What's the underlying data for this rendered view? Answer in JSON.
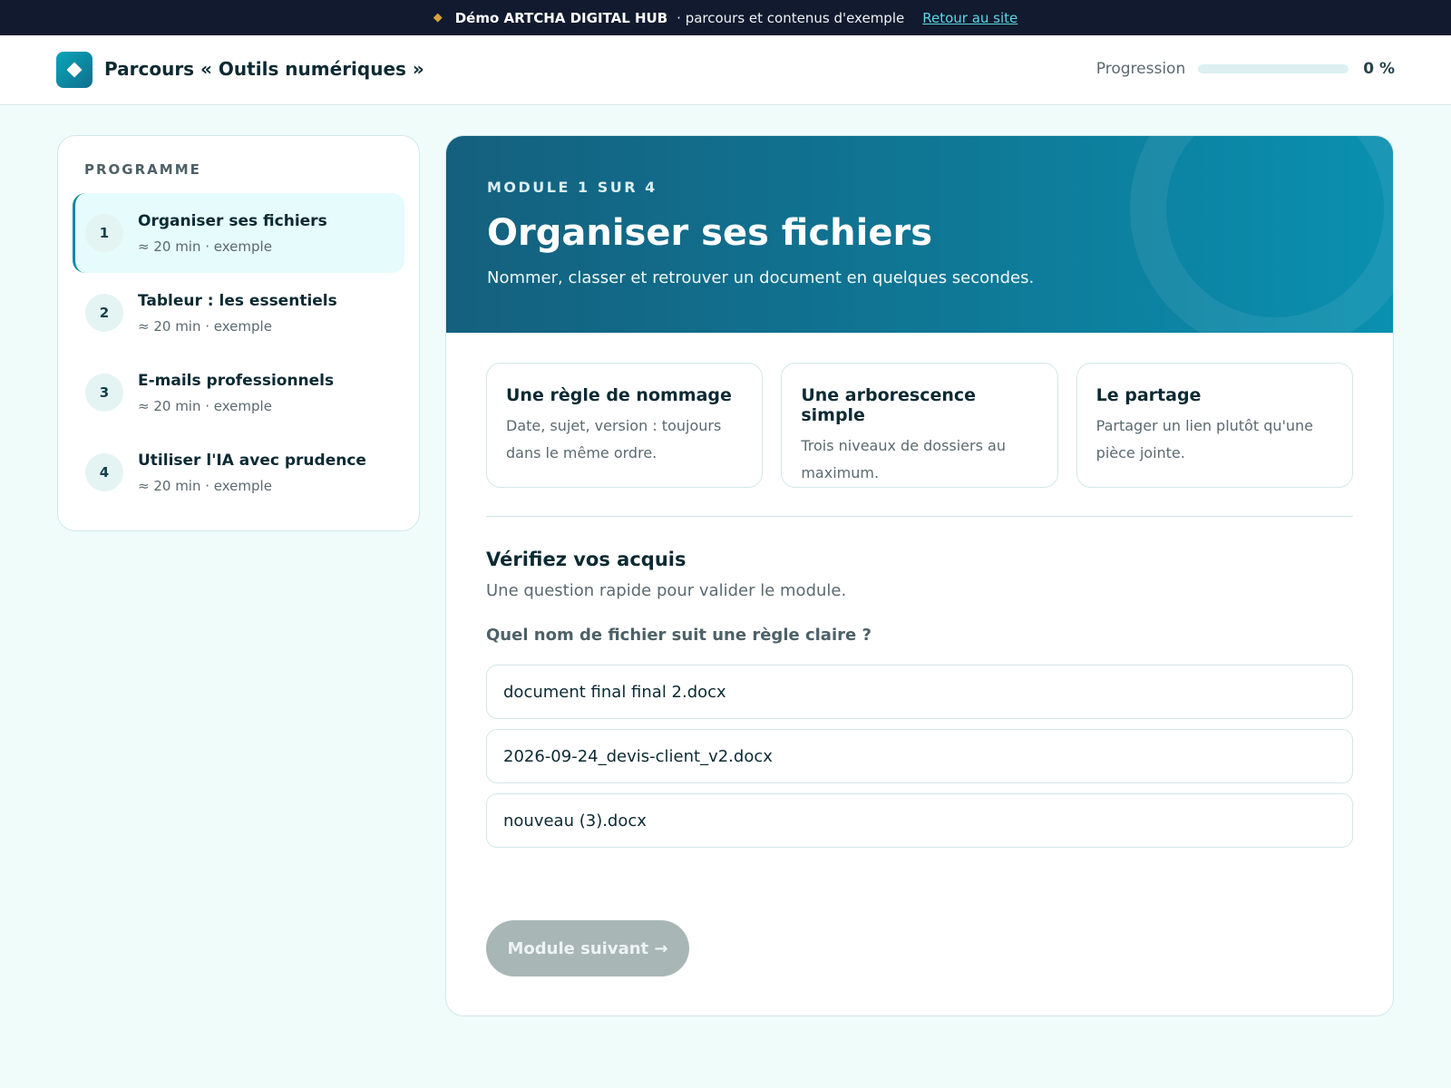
{
  "banner": {
    "brand": "Démo ARTCHA DIGITAL HUB",
    "text": "· parcours et contenus d'exemple",
    "link": "Retour au site"
  },
  "header": {
    "title": "Parcours « Outils numériques »",
    "progress_label": "Progression",
    "progress_value": "0 %",
    "progress_fraction": 0
  },
  "sidebar": {
    "title": "PROGRAMME",
    "items": [
      {
        "num": "1",
        "label": "Organiser ses fichiers",
        "meta": "≈ 20 min · exemple"
      },
      {
        "num": "2",
        "label": "Tableur : les essentiels",
        "meta": "≈ 20 min · exemple"
      },
      {
        "num": "3",
        "label": "E-mails professionnels",
        "meta": "≈ 20 min · exemple"
      },
      {
        "num": "4",
        "label": "Utiliser l'IA avec prudence",
        "meta": "≈ 20 min · exemple"
      }
    ]
  },
  "module": {
    "kicker": "MODULE 1 SUR 4",
    "title": "Organiser ses fichiers",
    "subtitle": "Nommer, classer et retrouver un document en quelques secondes.",
    "cards": [
      {
        "title": "Une règle de nommage",
        "text": "Date, sujet, version : toujours dans le même ordre."
      },
      {
        "title": "Une arborescence simple",
        "text": "Trois niveaux de dossiers au maximum."
      },
      {
        "title": "Le partage",
        "text": "Partager un lien plutôt qu'une pièce jointe."
      }
    ]
  },
  "quiz": {
    "title": "Vérifiez vos acquis",
    "subtitle": "Une question rapide pour valider le module.",
    "question": "Quel nom de fichier suit une règle claire ?",
    "options": [
      "document final final 2.docx",
      "2026-09-24_devis-client_v2.docx",
      "nouveau (3).docx"
    ],
    "next_label": "Module suivant →"
  },
  "colors": {
    "accent": "#0e8aa5",
    "banner_bg": "#111a2e",
    "page_bg": "#effcfa",
    "disabled_button": "#a8b6b6"
  }
}
